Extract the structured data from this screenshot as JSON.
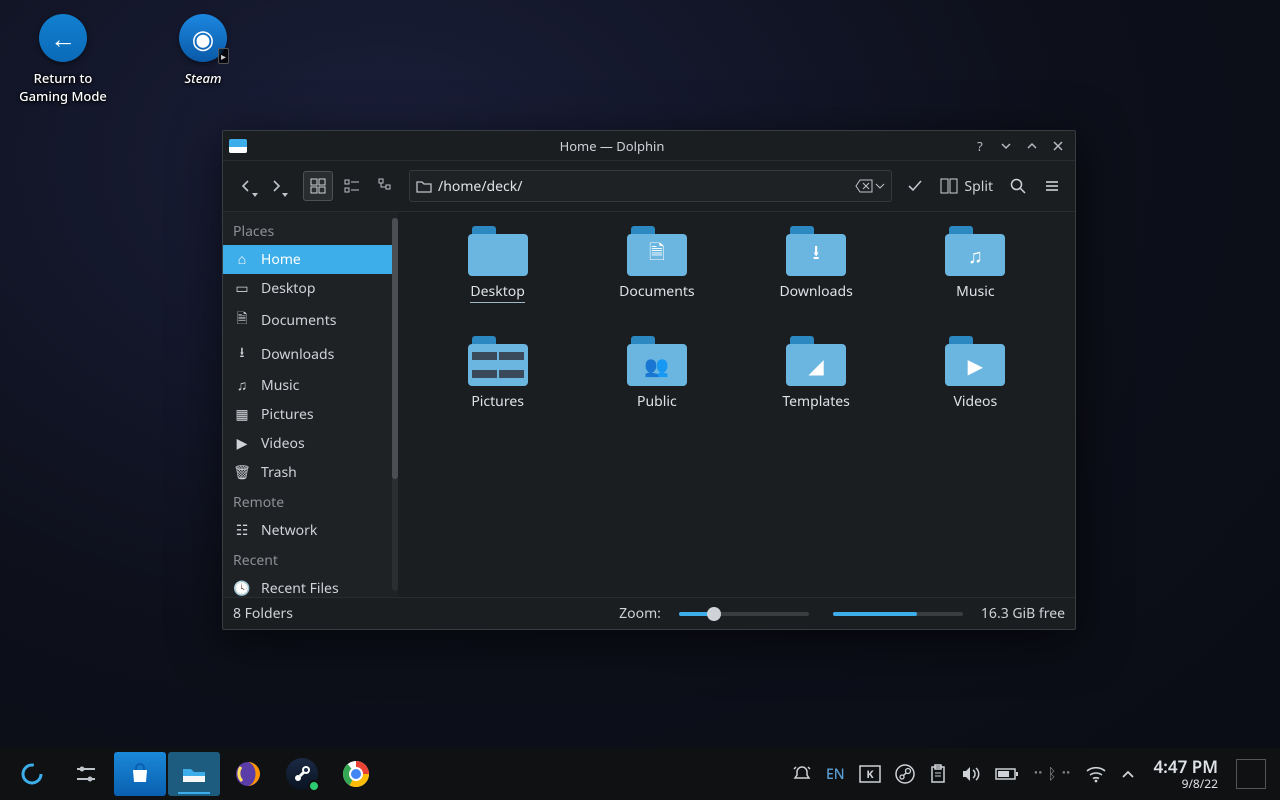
{
  "desktop": {
    "return_label": "Return to\nGaming Mode",
    "steam_label": "Steam"
  },
  "window": {
    "title": "Home — Dolphin",
    "path": "/home/deck/",
    "split_label": "Split"
  },
  "sidebar": {
    "places_label": "Places",
    "remote_label": "Remote",
    "recent_label": "Recent",
    "items": [
      {
        "label": "Home"
      },
      {
        "label": "Desktop"
      },
      {
        "label": "Documents"
      },
      {
        "label": "Downloads"
      },
      {
        "label": "Music"
      },
      {
        "label": "Pictures"
      },
      {
        "label": "Videos"
      },
      {
        "label": "Trash"
      }
    ],
    "network_label": "Network",
    "recent_files_label": "Recent Files"
  },
  "folders": [
    {
      "label": "Desktop"
    },
    {
      "label": "Documents"
    },
    {
      "label": "Downloads"
    },
    {
      "label": "Music"
    },
    {
      "label": "Pictures"
    },
    {
      "label": "Public"
    },
    {
      "label": "Templates"
    },
    {
      "label": "Videos"
    }
  ],
  "status": {
    "count": "8 Folders",
    "zoom_label": "Zoom:",
    "free": "16.3 GiB free"
  },
  "tray": {
    "lang": "EN"
  },
  "clock": {
    "time": "4:47 PM",
    "date": "9/8/22"
  }
}
